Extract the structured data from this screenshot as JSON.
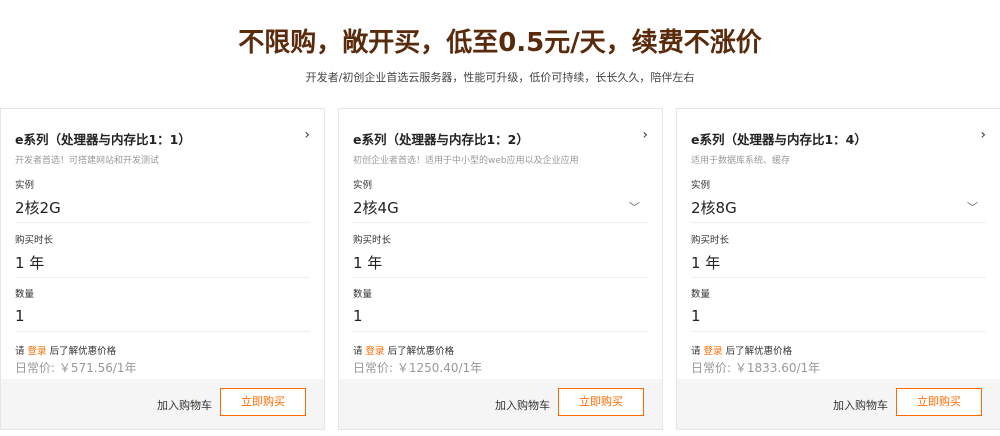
{
  "hero": {
    "title": "不限购，敞开买，低至0.5元/天，续费不涨价",
    "subtitle": "开发者/初创企业首选云服务器，性能可升级，低价可持续，长长久久，陪伴左右"
  },
  "cards": [
    {
      "title": "e系列（处理器与内存比1：1）",
      "desc": "开发者首选！可搭建网站和开发测试",
      "instance_label": "实例",
      "instance_value": "2核2G",
      "duration_label": "购买时长",
      "duration_value": "1 年",
      "quantity_label": "数量",
      "quantity_value": "1",
      "login_prefix": "请",
      "login_link": "登录",
      "login_suffix": "后了解优惠价格",
      "price": "日常价: ￥571.56/1年",
      "cart_label": "加入购物车",
      "buy_label": "立即购买"
    },
    {
      "title": "e系列（处理器与内存比1：2）",
      "desc": "初创企业者首选！适用于中小型的web应用以及企业应用",
      "instance_label": "实例",
      "instance_value": "2核4G",
      "duration_label": "购买时长",
      "duration_value": "1 年",
      "quantity_label": "数量",
      "quantity_value": "1",
      "login_prefix": "请",
      "login_link": "登录",
      "login_suffix": "后了解优惠价格",
      "price": "日常价: ￥1250.40/1年",
      "cart_label": "加入购物车",
      "buy_label": "立即购买"
    },
    {
      "title": "e系列（处理器与内存比1：4）",
      "desc": "适用于数据库系统、缓存",
      "instance_label": "实例",
      "instance_value": "2核8G",
      "duration_label": "购买时长",
      "duration_value": "1 年",
      "quantity_label": "数量",
      "quantity_value": "1",
      "login_prefix": "请",
      "login_link": "登录",
      "login_suffix": "后了解优惠价格",
      "price": "日常价: ￥1833.60/1年",
      "cart_label": "加入购物车",
      "buy_label": "立即购买"
    }
  ],
  "icons": {
    "arrow": "chevron-right-icon",
    "dropdown": "chevron-down-icon"
  },
  "colors": {
    "title": "#5a2a0c",
    "accent": "#ff6a00"
  }
}
